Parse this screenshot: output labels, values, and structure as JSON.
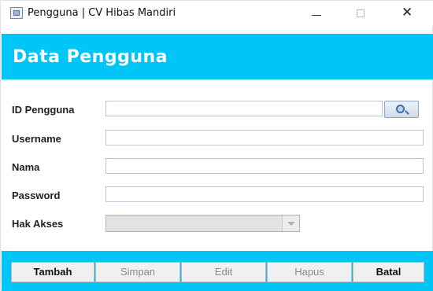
{
  "window": {
    "title": "Pengguna | CV Hibas Mandiri",
    "minimize_glyph": "—",
    "maximize_glyph": "□",
    "close_glyph": "✕"
  },
  "header": {
    "title": "Data Pengguna",
    "band_color": "#00c6f8"
  },
  "form": {
    "id_label": "ID Pengguna",
    "id_value": "",
    "search_icon": "search-icon",
    "username_label": "Username",
    "username_value": "",
    "nama_label": "Nama",
    "nama_value": "",
    "password_label": "Password",
    "password_value": "",
    "hak_akses_label": "Hak Akses",
    "hak_akses_value": ""
  },
  "toolbar": {
    "tambah_label": "Tambah",
    "simpan_label": "Simpan",
    "edit_label": "Edit",
    "hapus_label": "Hapus",
    "batal_label": "Batal"
  }
}
